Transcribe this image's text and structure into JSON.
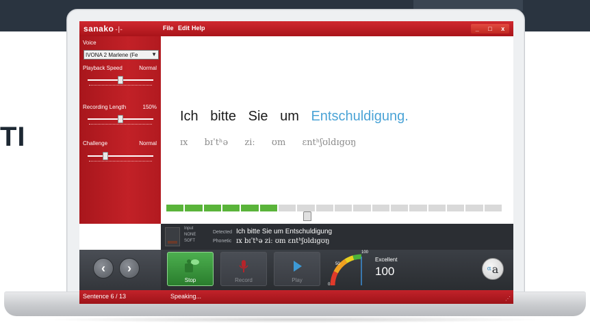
{
  "page": {
    "side_text": "TI"
  },
  "titlebar": {
    "logo": "sanako",
    "logo_mark": "-|-",
    "menu": [
      "File",
      "Edit",
      "Help"
    ],
    "window_buttons": [
      "_",
      "□",
      "x"
    ]
  },
  "sidebar": {
    "voice_label": "Voice",
    "voice_value": "IVONA 2 Marlene (Fe",
    "playback_label": "Playback Speed",
    "playback_value": "Normal",
    "playback_level": 0.5,
    "recording_label": "Recording Length",
    "recording_value": "150%",
    "recording_level": 0.5,
    "challenge_label": "Challenge",
    "challenge_value": "Normal",
    "challenge_level": 0.25
  },
  "main": {
    "words": [
      "Ich",
      "bitte",
      "Sie",
      "um"
    ],
    "highlight_word": "Entschuldigung.",
    "phonetic": [
      "ɪx",
      "bɪˈtʰə",
      "ziː",
      "ʊm",
      "ɛntʰʃʊldɪgʊŋ"
    ],
    "progress_segments": 18,
    "progress_filled": 6
  },
  "detect": {
    "input_label": "Input",
    "input_none": "NONE",
    "input_soft": "SOFT",
    "detected_label": "Detected",
    "detected_value": "Ich bitte Sie um Entschuldigung",
    "phonetic_label": "Phonetic",
    "phonetic_value": "ɪx bɪˈtʰə ziː ʊm ɛntʰʃʊldɪgʊŋ"
  },
  "controls": {
    "prev_glyph": "‹",
    "next_glyph": "›",
    "stop_label": "Stop",
    "record_label": "Record",
    "play_label": "Play",
    "gauge_max": "100",
    "gauge_min": "0",
    "gauge_mid": "50",
    "score_label": "Excellent",
    "score_value": "100",
    "alpha_small": "α",
    "alpha_big": "a"
  },
  "status": {
    "sentence": "Sentence 6 / 13",
    "state": "Speaking..."
  },
  "colors": {
    "brand_red": "#c22127",
    "progress_green": "#5ab43a",
    "highlight_blue": "#4aa3d6",
    "stop_green": "#2a7d2d"
  }
}
